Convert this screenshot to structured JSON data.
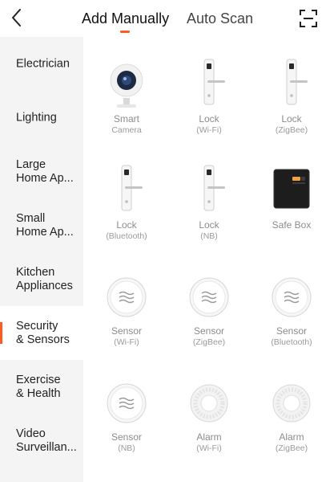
{
  "header": {
    "tabs": [
      {
        "label": "Add Manually",
        "active": true
      },
      {
        "label": "Auto Scan",
        "active": false
      }
    ],
    "accent": "#ff5a1f"
  },
  "sidebar": {
    "items": [
      {
        "label": "Electrician"
      },
      {
        "label": "Lighting"
      },
      {
        "label": "Large\nHome Ap..."
      },
      {
        "label": "Small\nHome Ap..."
      },
      {
        "label": "Kitchen\nAppliances"
      },
      {
        "label": "Security\n& Sensors",
        "selected": true
      },
      {
        "label": "Exercise\n& Health"
      },
      {
        "label": "Video\nSurveillan..."
      }
    ]
  },
  "devices": [
    {
      "name": "Smart",
      "sub": "Camera",
      "icon": "camera-icon"
    },
    {
      "name": "Lock",
      "sub": "(Wi-Fi)",
      "icon": "lock-icon"
    },
    {
      "name": "Lock",
      "sub": "(ZigBee)",
      "icon": "lock-icon"
    },
    {
      "name": "Lock",
      "sub": "(Bluetooth)",
      "icon": "lock-icon"
    },
    {
      "name": "Lock",
      "sub": "(NB)",
      "icon": "lock-icon"
    },
    {
      "name": "Safe Box",
      "sub": "",
      "icon": "safe-box-icon"
    },
    {
      "name": "Sensor",
      "sub": "(Wi-Fi)",
      "icon": "sensor-icon"
    },
    {
      "name": "Sensor",
      "sub": "(ZigBee)",
      "icon": "sensor-icon"
    },
    {
      "name": "Sensor",
      "sub": "(Bluetooth)",
      "icon": "sensor-icon"
    },
    {
      "name": "Sensor",
      "sub": "(NB)",
      "icon": "sensor-icon"
    },
    {
      "name": "Alarm",
      "sub": "(Wi-Fi)",
      "icon": "alarm-icon"
    },
    {
      "name": "Alarm",
      "sub": "(ZigBee)",
      "icon": "alarm-icon"
    }
  ]
}
